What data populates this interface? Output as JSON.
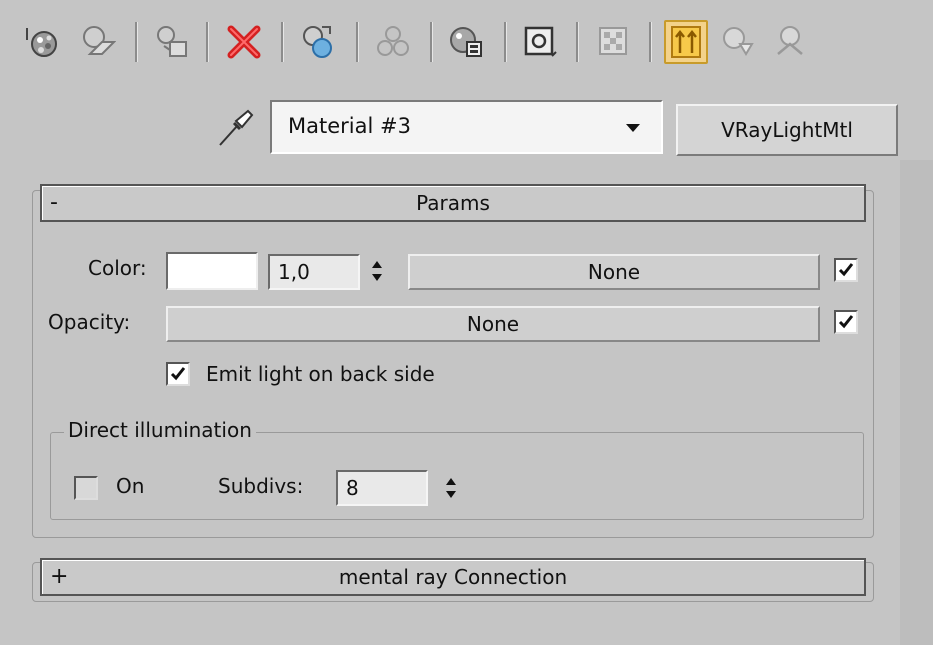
{
  "toolbar": {
    "icons": [
      "get-material-icon",
      "put-to-scene-icon",
      "assign-to-selection-icon",
      "reset-map-icon",
      "make-unique-icon",
      "put-to-library-icon",
      "material-id-channel-icon",
      "show-map-in-viewport-icon",
      "show-end-result-icon",
      "go-to-parent-icon",
      "go-forward-to-sibling-icon",
      "go-to-sibling-icon"
    ]
  },
  "material": {
    "name": "Material #3",
    "type": "VRayLightMtl"
  },
  "params": {
    "header_sign": "-",
    "header": "Params",
    "color_label": "Color:",
    "color_swatch": "#ffffff",
    "color_multiplier": "1,0",
    "color_map": "None",
    "color_map_enabled": true,
    "opacity_label": "Opacity:",
    "opacity_map": "None",
    "opacity_map_enabled": true,
    "emit_back_label": "Emit light on back side",
    "emit_back_checked": true,
    "direct_group_title": "Direct illumination",
    "direct_on_label": "On",
    "direct_on_checked": false,
    "subdivs_label": "Subdivs:",
    "subdivs_value": "8"
  },
  "mental_ray": {
    "header_sign": "+",
    "header": "mental ray Connection"
  },
  "colors": {
    "panel": "#c5c5c5",
    "active_tool": "#f3d28a"
  }
}
